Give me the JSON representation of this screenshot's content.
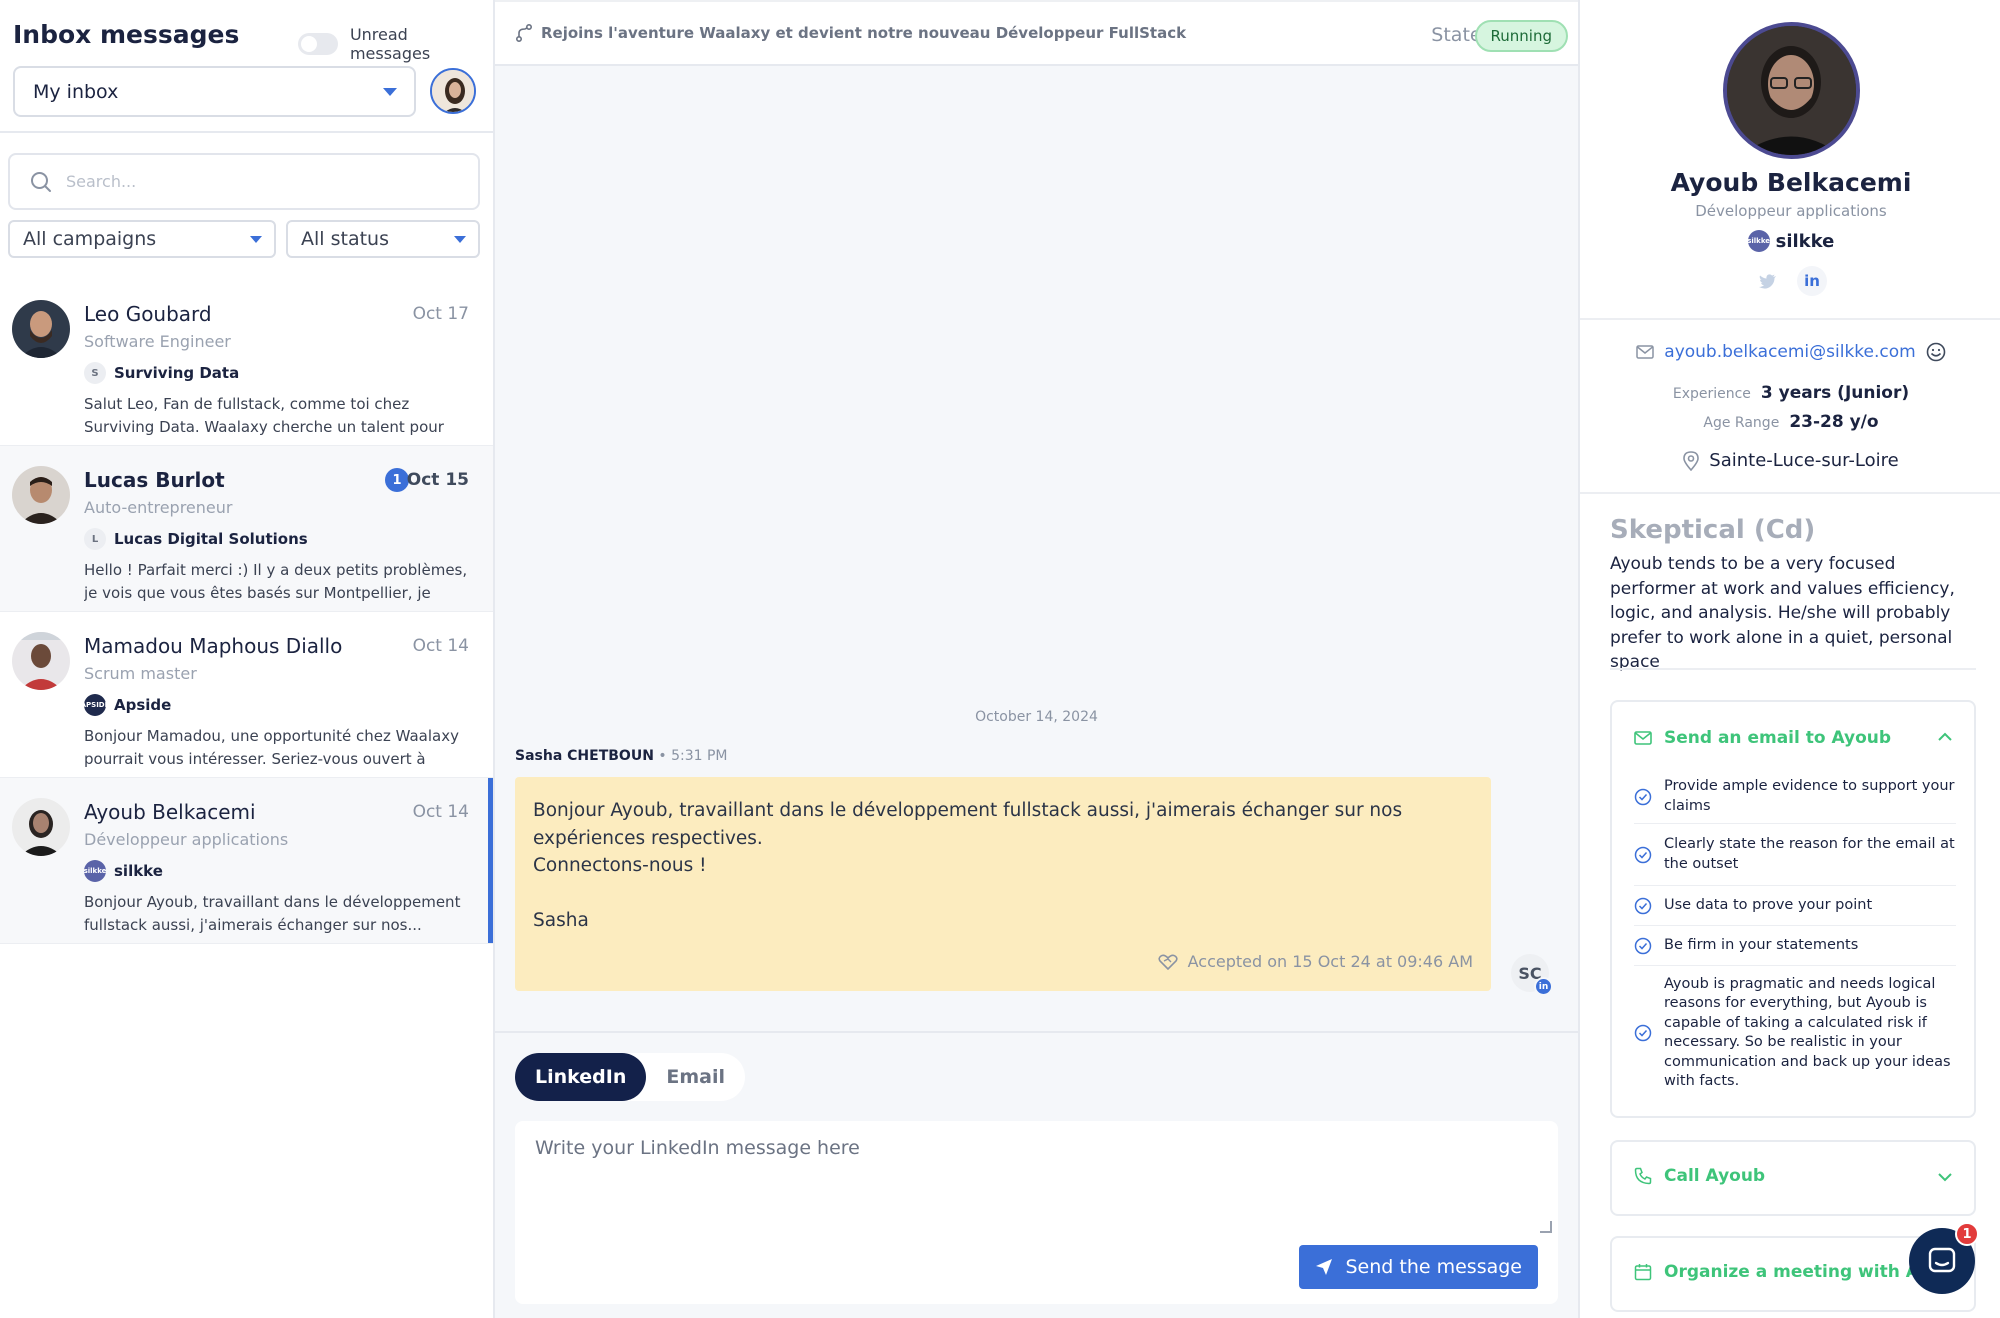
{
  "left": {
    "title": "Inbox messages",
    "unread_label": "Unread messages",
    "inbox_select": "My inbox",
    "search_placeholder": "Search...",
    "filter_campaigns": "All campaigns",
    "filter_status": "All status",
    "conversations": [
      {
        "name": "Leo Goubard",
        "date": "Oct 17",
        "role": "Software Engineer",
        "company_initial": "S",
        "company": "Surviving Data",
        "preview": "Salut Leo, Fan de fullstack, comme toi chez Surviving Data. Waalaxy cherche un talent pour révolutionner..."
      },
      {
        "name": "Lucas Burlot",
        "date": "Oct 15",
        "unread": "1",
        "role": "Auto-entrepreneur",
        "company_initial": "L",
        "company": "Lucas Digital Solutions",
        "preview": "Hello ! Parfait merci :) Il y a deux petits problèmes, je vois que vous êtes basés sur Montpellier, je suis..."
      },
      {
        "name": "Mamadou Maphous Diallo",
        "date": "Oct 14",
        "role": "Scrum master",
        "company_initial": "APSIDE",
        "company": "Apside",
        "preview": "Bonjour Mamadou, une opportunité chez Waalaxy pourrait vous intéresser. Seriez-vous ouvert à discut..."
      },
      {
        "name": "Ayoub Belkacemi",
        "date": "Oct 14",
        "role": "Développeur applications",
        "company_initial": "silkke",
        "company": "silkke",
        "preview": "Bonjour Ayoub, travaillant dans le développement fullstack aussi, j'aimerais échanger sur nos..."
      }
    ]
  },
  "middle": {
    "campaign": "Rejoins l'aventure Waalaxy et devient notre nouveau Développeur FullStack",
    "state_label": "State:",
    "state_value": "Running",
    "date_separator": "October 14, 2024",
    "sender": "Sasha CHETBOUN",
    "time": "5:31 PM",
    "message": "Bonjour Ayoub, travaillant dans le développement fullstack aussi, j'aimerais échanger sur nos expériences respectives.\nConnectons-nous !\n\nSasha",
    "accepted": "Accepted on 15 Oct 24 at 09:46 AM",
    "sender_initials": "SC",
    "linkedin_badge": "in",
    "tab_linkedin": "LinkedIn",
    "tab_email": "Email",
    "compose_placeholder": "Write your LinkedIn message here",
    "send_label": "Send the message"
  },
  "right": {
    "name": "Ayoub Belkacemi",
    "role": "Développeur applications",
    "company": "silkke",
    "company_logo_text": "silkke",
    "linkedin_glyph": "in",
    "email": "ayoub.belkacemi@silkke.com",
    "experience_label": "Experience",
    "experience_value": "3 years (Junior)",
    "age_label": "Age Range",
    "age_value": "23-28 y/o",
    "location": "Sainte-Luce-sur-Loire",
    "disc_title": "Skeptical (Cd)",
    "disc_description": "Ayoub tends to be a very focused performer at work and values efficiency, logic, and analysis. He/she will probably prefer to work alone in a quiet, personal space",
    "email_card_title": "Send an email to Ayoub",
    "email_tips": [
      "Provide ample evidence to support your claims",
      "Clearly state the reason for the email at the outset",
      "Use data to prove your point",
      "Be firm in your statements",
      "Ayoub is pragmatic and needs logical reasons for everything, but Ayoub is capable of taking a calculated risk if necessary. So be realistic in your communication and back up your ideas with facts."
    ],
    "call_card_title": "Call Ayoub",
    "meeting_card_title": "Organize a meeting with Ayoub",
    "chat_badge": "1"
  },
  "colors": {
    "accent": "#3b6fd8",
    "navy": "#13214a",
    "bubble": "#fcecbf",
    "success": "#3ec47a",
    "running_bg": "#d6f5df"
  },
  "icons": [
    "search-icon",
    "caret-down-icon",
    "branch-icon",
    "heart-handshake-icon",
    "send-icon",
    "twitter-icon",
    "linkedin-icon",
    "mail-icon",
    "smile-icon",
    "location-pin-icon",
    "check-circle-icon",
    "chevron-up-icon",
    "chevron-down-icon",
    "phone-icon",
    "calendar-icon",
    "chat-icon"
  ]
}
